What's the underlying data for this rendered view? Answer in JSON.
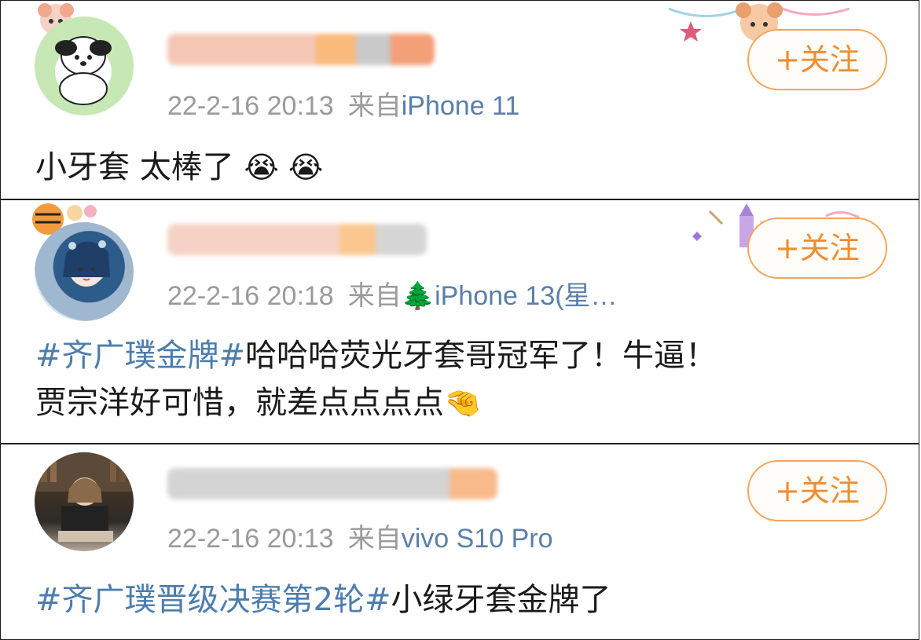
{
  "posts": [
    {
      "timestamp": "22-2-16 20:13",
      "from_label": "来自",
      "source": "iPhone 11",
      "follow_label": "+关注",
      "content": {
        "text": "小牙套 太棒了",
        "emoji": "😭 😭"
      }
    },
    {
      "timestamp": "22-2-16 20:18",
      "from_label": "来自",
      "source": "🌲iPhone 13(星…",
      "follow_label": "+关注",
      "content": {
        "hashtag": "#齐广璞金牌#",
        "text_line1": "哈哈哈荧光牙套哥冠军了！牛逼！",
        "text_line2": "贾宗洋好可惜，就差点点点点",
        "emoji": "🤏"
      }
    },
    {
      "timestamp": "22-2-16 20:13",
      "from_label": "来自",
      "source": "vivo S10 Pro",
      "follow_label": "+关注",
      "content": {
        "hashtag": "#齐广璞晋级决赛第2轮#",
        "text": "小绿牙套金牌了"
      }
    }
  ],
  "colors": {
    "link": "#4c7dae",
    "meta": "#9a9a9a",
    "follow": "#ef8d2f",
    "follow_border": "#f4a45a"
  }
}
